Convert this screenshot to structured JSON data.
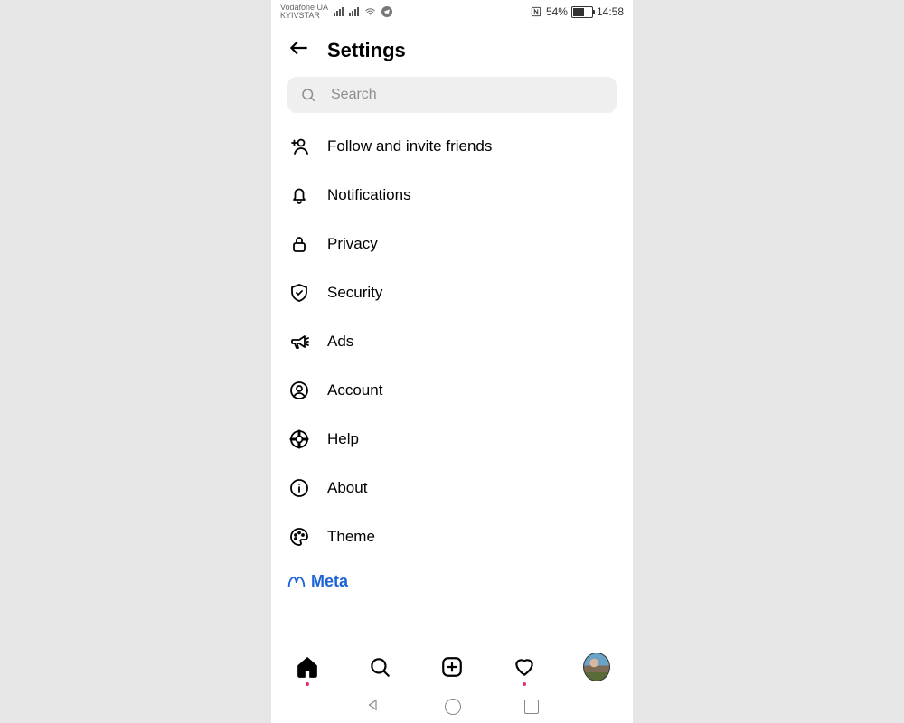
{
  "status": {
    "carrier_line1": "Vodafone UA",
    "carrier_line2": "KYIVSTAR",
    "battery_percent": "54%",
    "time": "14:58"
  },
  "header": {
    "title": "Settings"
  },
  "search": {
    "placeholder": "Search",
    "value": ""
  },
  "menu": {
    "items": [
      {
        "label": "Follow and invite friends"
      },
      {
        "label": "Notifications"
      },
      {
        "label": "Privacy"
      },
      {
        "label": "Security"
      },
      {
        "label": "Ads"
      },
      {
        "label": "Account"
      },
      {
        "label": "Help"
      },
      {
        "label": "About"
      },
      {
        "label": "Theme"
      }
    ]
  },
  "footer": {
    "brand": "Meta"
  }
}
